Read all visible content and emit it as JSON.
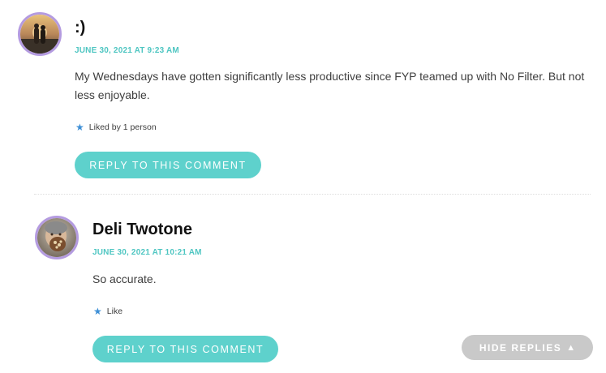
{
  "comments": [
    {
      "author": ":)",
      "date": "JUNE 30, 2021 AT 9:23 AM",
      "text": "My Wednesdays have gotten significantly less productive since FYP teamed up with No Filter. But not less enjoyable.",
      "like_icon": "star-icon",
      "like_text": "Liked by 1 person",
      "reply_label": "REPLY TO THIS COMMENT"
    },
    {
      "author": "Deli Twotone",
      "date": "JUNE 30, 2021 AT 10:21 AM",
      "text": "So accurate.",
      "like_icon": "star-icon",
      "like_text": "Like",
      "reply_label": "REPLY TO THIS COMMENT"
    }
  ],
  "hide_replies": {
    "label": "HIDE REPLIES",
    "icon": "triangle-up-icon"
  },
  "colors": {
    "accent": "#5ed1cc",
    "date": "#4fc6c2",
    "avatar_border": "#b49be0",
    "star": "#3d8fd6",
    "hide_replies_bg": "#c9c9c9"
  }
}
